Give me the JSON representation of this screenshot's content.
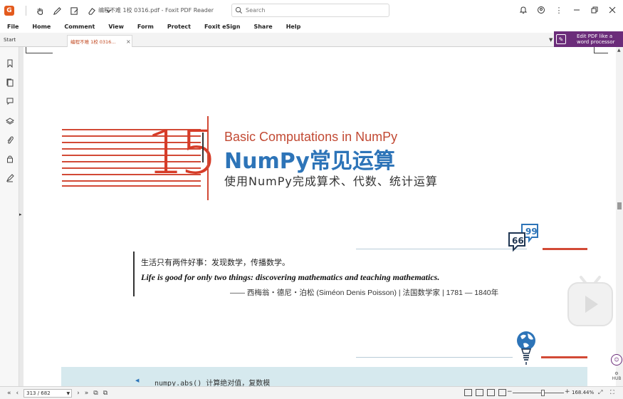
{
  "titlebar": {
    "title": "编程不难 1校 0316.pdf - Foxit PDF Reader",
    "search_placeholder": "Search",
    "logo_text": "G",
    "tools": [
      "hand-icon",
      "pen-icon",
      "edit-icon",
      "eraser-icon",
      "chevron-down-icon"
    ],
    "right_icons": [
      "bell-icon",
      "user-icon",
      "more-icon",
      "minimize-icon",
      "restore-icon",
      "close-icon"
    ]
  },
  "menu": {
    "items": [
      "File",
      "Home",
      "Comment",
      "View",
      "Form",
      "Protect",
      "Foxit eSign",
      "Share",
      "Help"
    ]
  },
  "tabs": {
    "start_label": "Start",
    "doc_label": "编程不难 1校 0316...",
    "close_label": "×",
    "promo_text_1": "Edit PDF like a",
    "promo_text_2": "word processor"
  },
  "sidebar": {
    "icons": [
      "bookmark-icon",
      "pages-icon",
      "comments-icon",
      "layers-icon",
      "attachment-icon",
      "security-icon",
      "signature-icon"
    ]
  },
  "document": {
    "chapter_number": "15",
    "english_title": "Basic Computations in NumPy",
    "chinese_title": "NumPy常见运算",
    "subtitle": "使用NumPy完成算术、代数、统计运算",
    "quote_cn": "生活只有两件好事：发现数学，传播数学。",
    "quote_en": "Life is good for only two things: discovering mathematics and teaching mathematics.",
    "quote_attr": "—— 西梅翁・德尼・泊松 (Siméon Denis Poisson) | 法国数学家 | 1781 — 1840年",
    "code_line_fn": "numpy.abs()",
    "code_line_desc": "计算绝对值，复数模"
  },
  "statusbar": {
    "page_value": "313 / 682",
    "zoom_value": "168.44%"
  },
  "colors": {
    "accent_red": "#d24a36",
    "accent_blue": "#2d74b8",
    "promo_purple": "#6b2c7a",
    "code_bg": "#d6e9ee"
  }
}
